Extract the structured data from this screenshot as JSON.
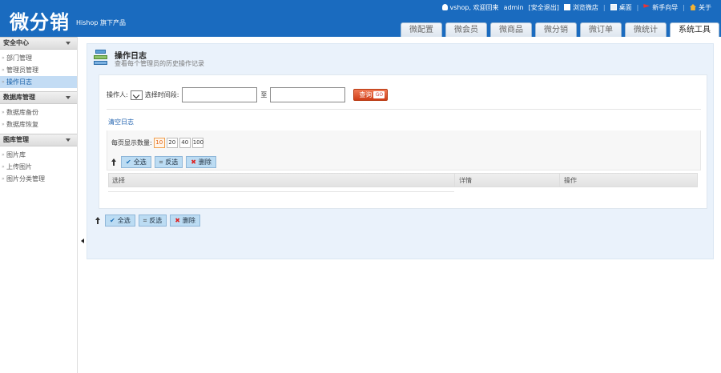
{
  "header": {
    "logo": "微分销",
    "logo_sub": "Hishop 旗下产品",
    "top_links": [
      {
        "icon": "user-icon",
        "label": "vshop, 欢迎回来"
      },
      {
        "icon": "",
        "label": "admin"
      },
      {
        "icon": "",
        "label": "[安全退出]"
      },
      {
        "icon": "store-icon",
        "label": "浏览微店"
      },
      {
        "icon": "monitor-icon",
        "label": "桌面"
      },
      {
        "icon": "flag-icon",
        "label": "新手向导"
      },
      {
        "icon": "home-icon",
        "label": "关于"
      }
    ]
  },
  "tabs": [
    {
      "label": "微配置",
      "active": false
    },
    {
      "label": "微会员",
      "active": false
    },
    {
      "label": "微商品",
      "active": false
    },
    {
      "label": "微分销",
      "active": false
    },
    {
      "label": "微订单",
      "active": false
    },
    {
      "label": "微统计",
      "active": false
    },
    {
      "label": "系统工具",
      "active": true
    }
  ],
  "sidebar": {
    "groups": [
      {
        "title": "安全中心",
        "items": [
          {
            "label": "部门管理",
            "active": false
          },
          {
            "label": "管理员管理",
            "active": false
          },
          {
            "label": "操作日志",
            "active": true
          }
        ]
      },
      {
        "title": "数据库管理",
        "items": [
          {
            "label": "数据库备份",
            "active": false
          },
          {
            "label": "数据库恢复",
            "active": false
          }
        ]
      },
      {
        "title": "图库管理",
        "items": [
          {
            "label": "图片库",
            "active": false
          },
          {
            "label": "上传图片",
            "active": false
          },
          {
            "label": "图片分类管理",
            "active": false
          }
        ]
      }
    ]
  },
  "page": {
    "title": "操作日志",
    "desc": "查看每个管理员的历史操作记录"
  },
  "search": {
    "operator_label": "操作人:",
    "time_label": "选择时间段:",
    "to_label": "至",
    "start_value": "",
    "end_value": "",
    "query_label": "查询",
    "go_label": "GO"
  },
  "clear_log": "清空日志",
  "perpage": {
    "label": "每页显示数量:",
    "options": [
      "10",
      "20",
      "40",
      "100"
    ],
    "selected": "10"
  },
  "batch": {
    "select_all": "全选",
    "invert": "反选",
    "delete": "删除"
  },
  "table": {
    "headers": [
      "选择",
      "详情",
      "操作"
    ]
  },
  "colors": {
    "brand_blue": "#1a6bbf",
    "query_red": "#cf3e18",
    "link_blue": "#1c5fae"
  }
}
